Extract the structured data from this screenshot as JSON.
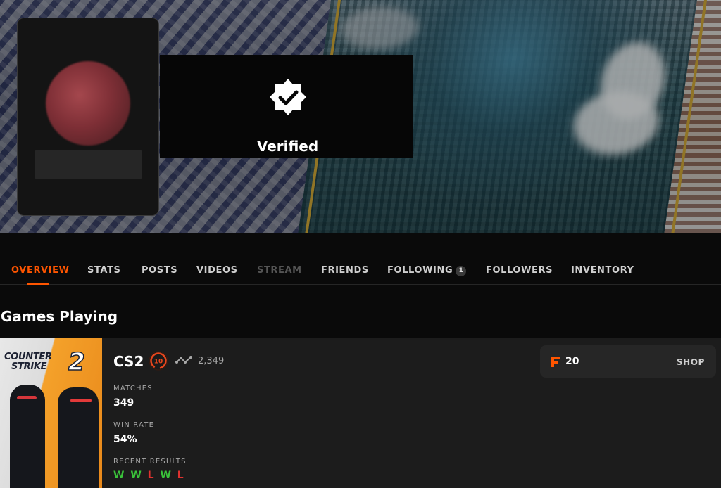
{
  "profile": {
    "verified_label": "Verified"
  },
  "tabs": [
    {
      "label": "OVERVIEW",
      "state": "active"
    },
    {
      "label": "STATS",
      "state": "normal"
    },
    {
      "label": "POSTS",
      "state": "normal"
    },
    {
      "label": "VIDEOS",
      "state": "normal"
    },
    {
      "label": "STREAM",
      "state": "disabled"
    },
    {
      "label": "FRIENDS",
      "state": "normal"
    },
    {
      "label": "FOLLOWING",
      "state": "normal",
      "badge": "1"
    },
    {
      "label": "FOLLOWERS",
      "state": "normal"
    },
    {
      "label": "INVENTORY",
      "state": "normal"
    }
  ],
  "section": {
    "title": "Games Playing"
  },
  "game": {
    "cover_title_line1": "COUNTER",
    "cover_title_line2": "STRIKE",
    "cover_number": "2",
    "name": "CS2",
    "level": "10",
    "elo": "2,349",
    "matches_label": "MATCHES",
    "matches_value": "349",
    "winrate_label": "WIN RATE",
    "winrate_value": "54%",
    "recent_label": "RECENT RESULTS",
    "recent_results": [
      "W",
      "W",
      "L",
      "W",
      "L"
    ]
  },
  "shop": {
    "points": "20",
    "shop_label": "SHOP"
  },
  "colors": {
    "accent": "#ff5500",
    "win": "#3ac33a",
    "loss": "#e0322f",
    "background": "#0a0a0a"
  }
}
